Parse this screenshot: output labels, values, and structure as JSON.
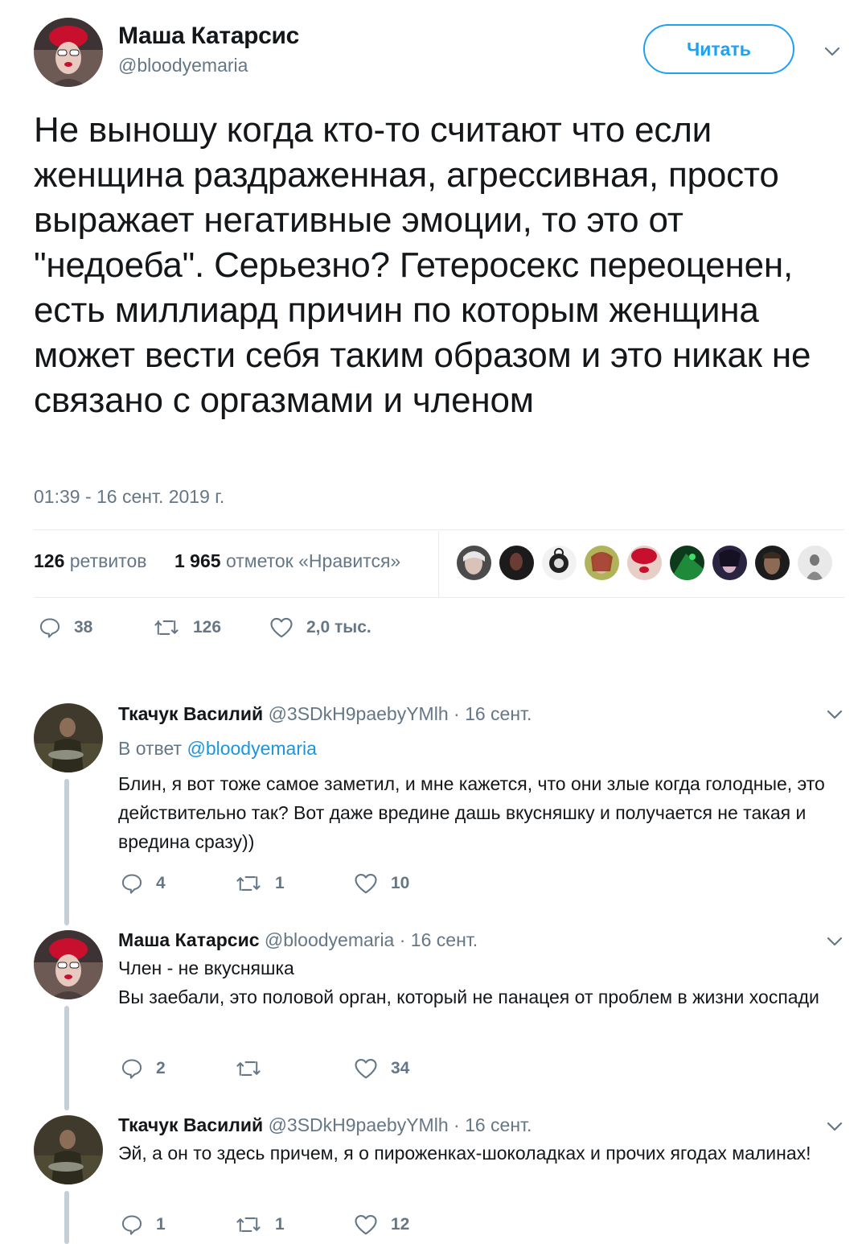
{
  "tweet": {
    "author_name": "Маша Катарсис",
    "author_handle": "@bloodyemaria",
    "follow_label": "Читать",
    "text": "Не выношу когда кто-то считают что если женщина раздраженная, агрессивная, просто выражает негативные эмоции, то это от \"недоеба\". Серьезно? Гетеросекс переоценен, есть миллиард причин по которым женщина может вести себя таким образом и это никак не связано с оргазмами и членом",
    "timestamp": "01:39 - 16 сент. 2019 г.",
    "retweets_count": "126",
    "retweets_label": "ретвитов",
    "likes_count": "1 965",
    "likes_label": "отметок «Нравится»",
    "actions": {
      "replies": "38",
      "retweets": "126",
      "likes": "2,0 тыс."
    },
    "likers": [
      "liker-1",
      "liker-2",
      "liker-3",
      "liker-4",
      "liker-5",
      "liker-6",
      "liker-7",
      "liker-8",
      "liker-9"
    ]
  },
  "replies": [
    {
      "name": "Ткачук Василий",
      "handle": "@3SDkH9paebyYMlh",
      "time": "· 16 сент.",
      "reply_to_label": "В ответ",
      "reply_to_handle": "@bloodyemaria",
      "text": "Блин, я вот тоже самое заметил, и мне кажется, что они злые когда голодные, это действительно так? Вот даже вредине дашь вкусняшку и получается не такая и вредина сразу))",
      "replies": "4",
      "retweets": "1",
      "likes": "10"
    },
    {
      "name": "Маша Катарсис",
      "handle": "@bloodyemaria",
      "time": "· 16 сент.",
      "text_line1": "Член - не вкусняшка",
      "text_line2": "Вы заебали, это половой орган, который не панацея от проблем в жизни хоспади",
      "replies": "2",
      "retweets": "",
      "likes": "34"
    },
    {
      "name": "Ткачук Василий",
      "handle": "@3SDkH9paebyYMlh",
      "time": "· 16 сент.",
      "text": "Эй, а он то здесь причем, я о пироженках-шоколадках и прочих ягодах малинах!",
      "replies": "1",
      "retweets": "1",
      "likes": "12"
    }
  ],
  "colors": {
    "accent": "#1da1f2",
    "mention": "#1b95e0",
    "muted": "#657786",
    "thread": "#c4cfd6"
  }
}
